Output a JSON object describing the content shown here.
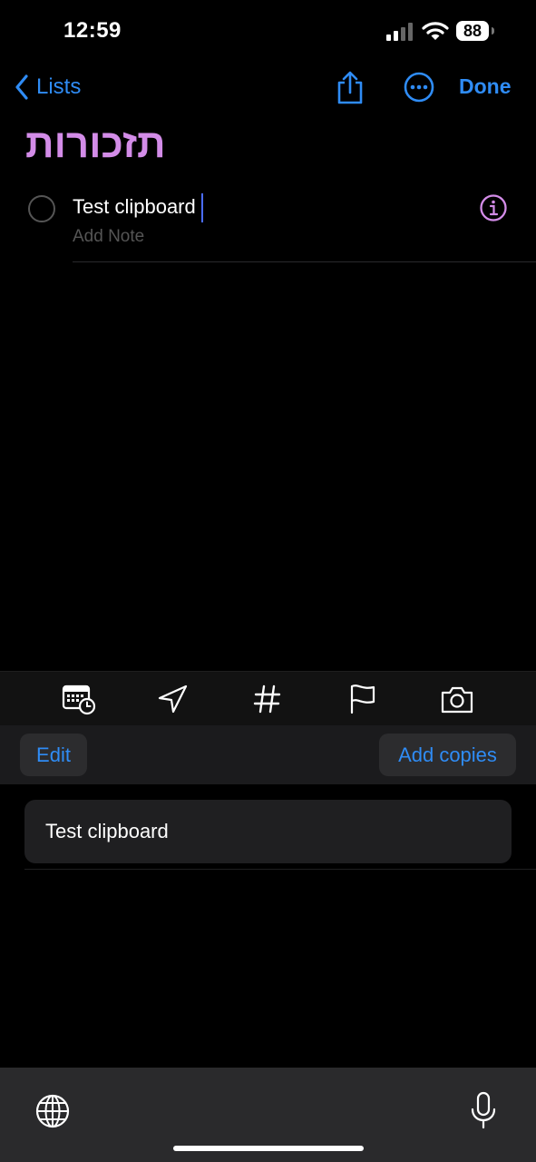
{
  "status_bar": {
    "time": "12:59",
    "battery": "88"
  },
  "nav": {
    "back_label": "Lists",
    "done_label": "Done"
  },
  "list_title": "תזכורות",
  "reminder": {
    "title": "Test clipboard",
    "note_placeholder": "Add Note"
  },
  "toolbar": {
    "icons": [
      "calendar-clock-icon",
      "location-icon",
      "hashtag-icon",
      "flag-icon",
      "camera-icon"
    ]
  },
  "clipboard": {
    "edit_label": "Edit",
    "add_copies_label": "Add copies",
    "items": [
      "Test clipboard"
    ]
  },
  "colors": {
    "accent": "#2f8cf5",
    "list_color": "#d38ce8",
    "background": "#000000"
  }
}
